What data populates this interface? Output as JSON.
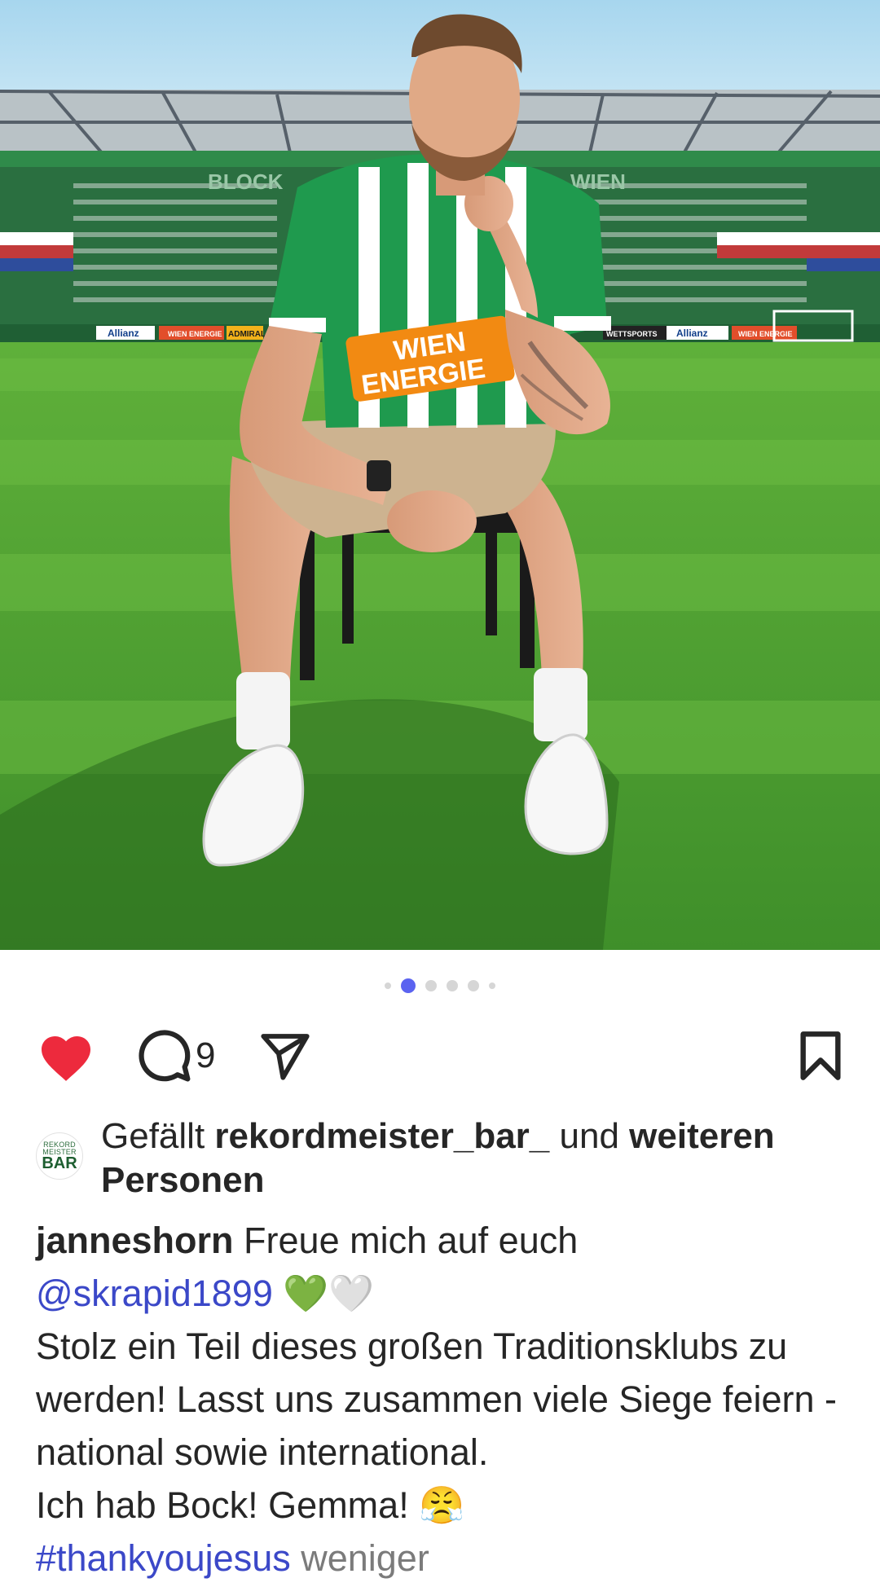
{
  "photo": {
    "description_icon": "post-photo",
    "jersey_sponsor_line1": "WIEN",
    "jersey_sponsor_line2": "ENERGIE",
    "ad_allianz": "Allianz",
    "ad_wien_energie": "WIEN ENERGIE",
    "ad_admiral": "ADMIRAL",
    "stand_left_text": "BLOCK",
    "stand_right_text": "WIEN",
    "ad_wettsports": "WETTSPORTS"
  },
  "carousel": {
    "count": 6,
    "active_index": 1
  },
  "actions": {
    "like_icon": "heart-filled-icon",
    "comment_icon": "comment-bubble-icon",
    "comment_count": "9",
    "share_icon": "paper-plane-icon",
    "save_icon": "bookmark-icon",
    "like_color": "#ed2a3d"
  },
  "likes": {
    "avatar_line1": "REKORD",
    "avatar_line2": "MEISTER",
    "avatar_line3": "BAR",
    "prefix": "Gefällt ",
    "user": "rekordmeister_bar_",
    "middle": " und ",
    "suffix": "weiteren Personen"
  },
  "caption": {
    "username": "janneshorn",
    "text1": " Freue mich auf euch",
    "mention": "@skrapid1899",
    "emojis1": "💚🤍",
    "line3": "Stolz ein Teil dieses großen Traditionsklubs zu werden! Lasst uns zusammen viele Siege feiern - national sowie international.",
    "line4": "Ich hab Bock! Gemma! 😤",
    "hashtag": "#thankyoujesus",
    "less_label": "weniger"
  },
  "colors": {
    "accent": "#5b63f0",
    "link": "#3b48c8",
    "muted": "#7b7b7b"
  }
}
